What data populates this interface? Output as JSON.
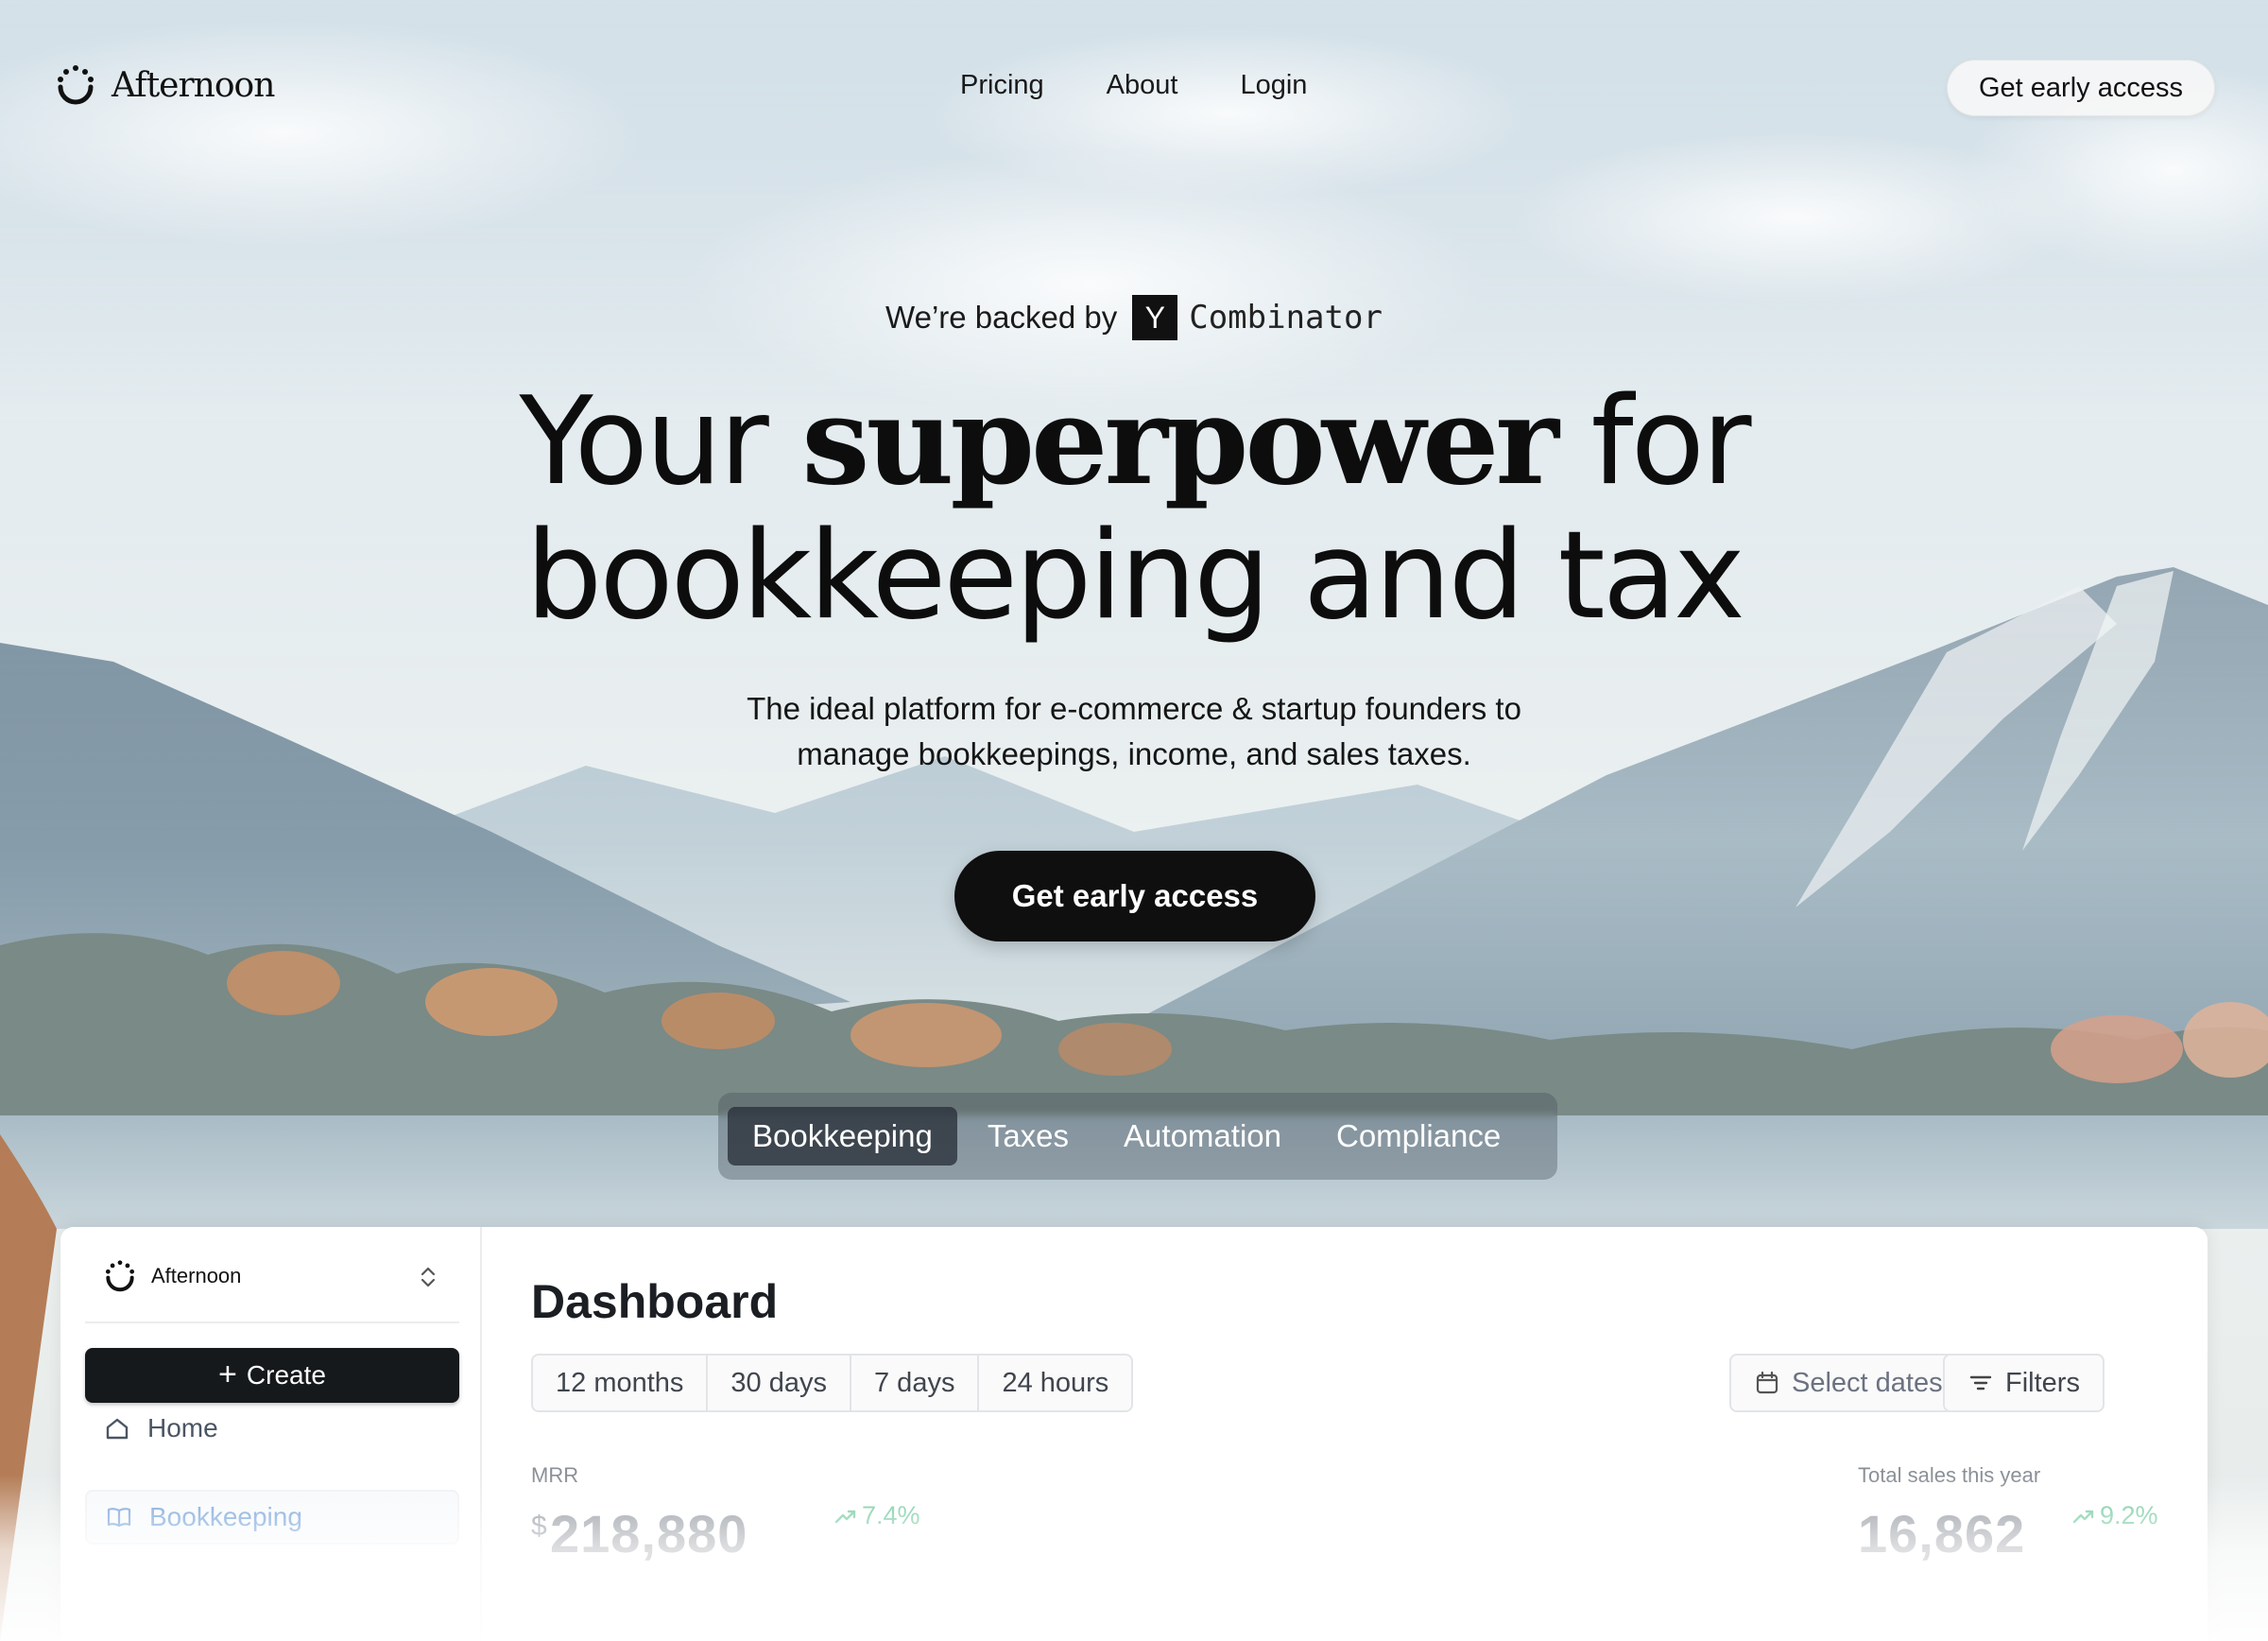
{
  "brand": {
    "name": "Afternoon"
  },
  "nav": {
    "items": [
      "Pricing",
      "About",
      "Login"
    ],
    "cta": "Get early access"
  },
  "hero": {
    "backed_prefix": "We’re backed by",
    "backer_mark": "Y",
    "backer_name": "Combinator",
    "headline_line1_start": "Your ",
    "headline_accent": "superpower",
    "headline_line1_end": " for",
    "headline_line2": "bookkeeping and tax",
    "subtitle_line1": "The ideal platform for e-commerce & startup founders to",
    "subtitle_line2": "manage bookkeepings, income, and sales taxes.",
    "cta": "Get early access"
  },
  "feature_tabs": {
    "items": [
      "Bookkeeping",
      "Taxes",
      "Automation",
      "Compliance"
    ],
    "active": "Bookkeeping"
  },
  "dashboard": {
    "workspace": "Afternoon",
    "create_label": "Create",
    "sidebar": [
      "Home",
      "Bookkeeping"
    ],
    "active_sidebar": "Bookkeeping",
    "title": "Dashboard",
    "ranges": [
      "12 months",
      "30 days",
      "7 days",
      "24 hours"
    ],
    "select_dates": "Select dates",
    "filters": "Filters",
    "metrics": [
      {
        "label": "MRR",
        "currency": "$",
        "value": "218,880",
        "delta": "7.4%"
      },
      {
        "label": "Total sales this year",
        "value": "16,862",
        "delta": "9.2%"
      }
    ]
  },
  "colors": {
    "accent_dark": "#0f0f0f",
    "delta_green": "#6bc79a",
    "active_sidebar_blue": "#6b9bd6"
  },
  "icons": [
    "logo-icon",
    "plus-icon",
    "home-icon",
    "book-icon",
    "calendar-icon",
    "filter-icon",
    "trend-up-icon",
    "chevron-updown-icon"
  ]
}
